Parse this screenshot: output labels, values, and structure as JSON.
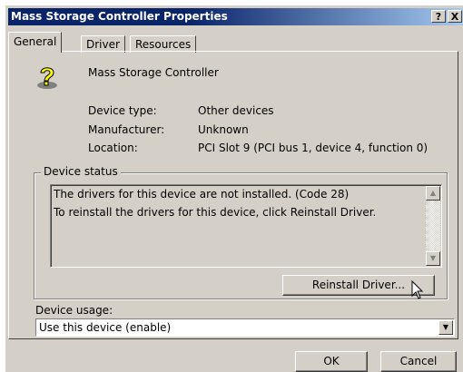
{
  "window": {
    "title": "Mass Storage Controller Properties",
    "help_button": "?",
    "close_button": "X"
  },
  "tabs": [
    {
      "label": "General"
    },
    {
      "label": "Driver"
    },
    {
      "label": "Resources"
    }
  ],
  "device": {
    "name": "Mass Storage Controller",
    "type_label": "Device type:",
    "type_value": "Other devices",
    "manufacturer_label": "Manufacturer:",
    "manufacturer_value": "Unknown",
    "location_label": "Location:",
    "location_value": "PCI Slot 9 (PCI bus 1, device 4, function 0)"
  },
  "status": {
    "group_label": "Device status",
    "line1": "The drivers for this device are not installed. (Code 28)",
    "line2": "To reinstall the drivers for this device, click Reinstall Driver.",
    "reinstall_button": "Reinstall Driver..."
  },
  "usage": {
    "label": "Device usage:",
    "selected": "Use this device (enable)"
  },
  "buttons": {
    "ok": "OK",
    "cancel": "Cancel"
  }
}
